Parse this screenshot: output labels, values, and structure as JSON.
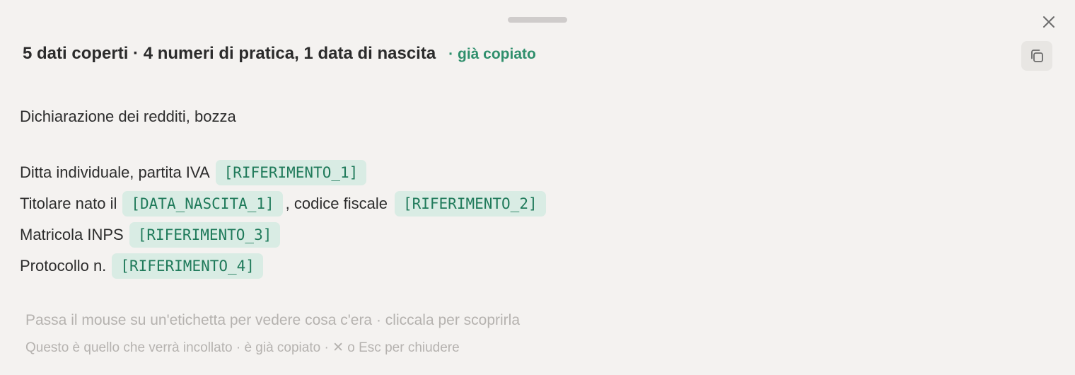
{
  "header": {
    "title": "5 dati coperti · 4 numeri di pratica, 1 data di nascita",
    "status": "· già copiato"
  },
  "document": {
    "title": "Dichiarazione dei redditi, bozza",
    "lines": [
      {
        "prefix": "Ditta individuale, partita IVA",
        "tag": "[RIFERIMENTO_1]"
      },
      {
        "prefix": "Titolare nato il",
        "tag": "[DATA_NASCITA_1]",
        "middle": ", codice fiscale",
        "tag2": "[RIFERIMENTO_2]"
      },
      {
        "prefix": "Matricola INPS",
        "tag": "[RIFERIMENTO_3]"
      },
      {
        "prefix": "Protocollo n.",
        "tag": "[RIFERIMENTO_4]"
      }
    ]
  },
  "hints": {
    "line1": "Passa il mouse su un'etichetta per vedere cosa c'era · cliccala per scoprirla",
    "line2": "Questo è quello che verrà incollato · è già copiato · ✕ o Esc per chiudere"
  },
  "icons": {
    "close": "close-icon",
    "copy": "copy-icon"
  },
  "colors": {
    "accent": "#2f8f6c",
    "tag_bg": "#d9ece4",
    "tag_text": "#1f7a5a",
    "background": "#f4f2f0"
  }
}
